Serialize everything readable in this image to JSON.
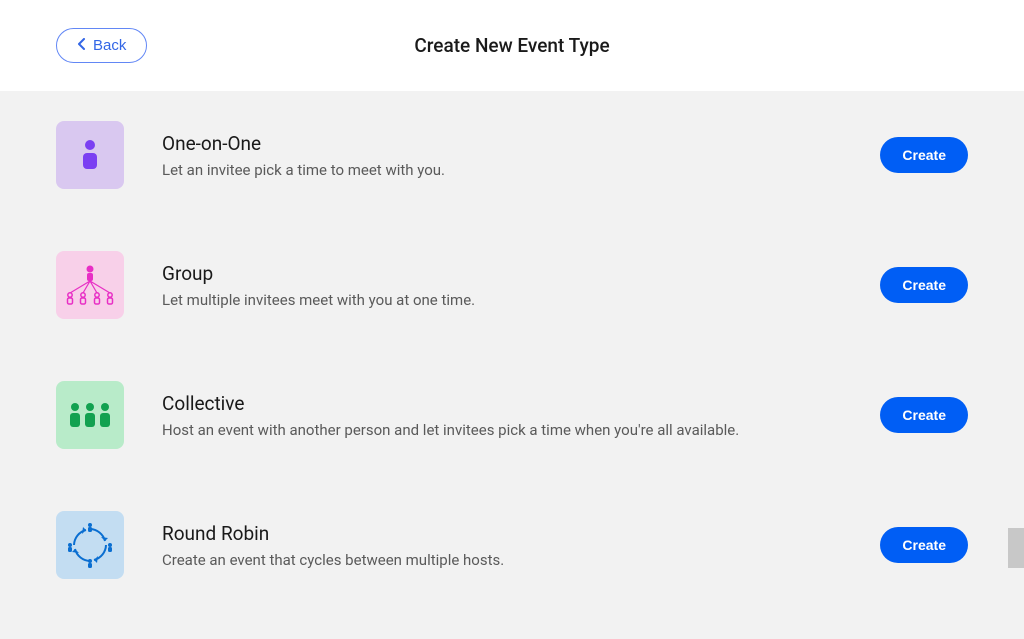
{
  "header": {
    "back_label": "Back",
    "page_title": "Create New Event Type"
  },
  "create_label": "Create",
  "event_types": [
    {
      "key": "one-on-one",
      "title": "One-on-One",
      "desc": "Let an invitee pick a time to meet with you.",
      "icon_class": "icon-purple"
    },
    {
      "key": "group",
      "title": "Group",
      "desc": "Let multiple invitees meet with you at one time.",
      "icon_class": "icon-pink"
    },
    {
      "key": "collective",
      "title": "Collective",
      "desc": "Host an event with another person and let invitees pick a time when you're all available.",
      "icon_class": "icon-green"
    },
    {
      "key": "round-robin",
      "title": "Round Robin",
      "desc": "Create an event that cycles between multiple hosts.",
      "icon_class": "icon-blue"
    }
  ]
}
